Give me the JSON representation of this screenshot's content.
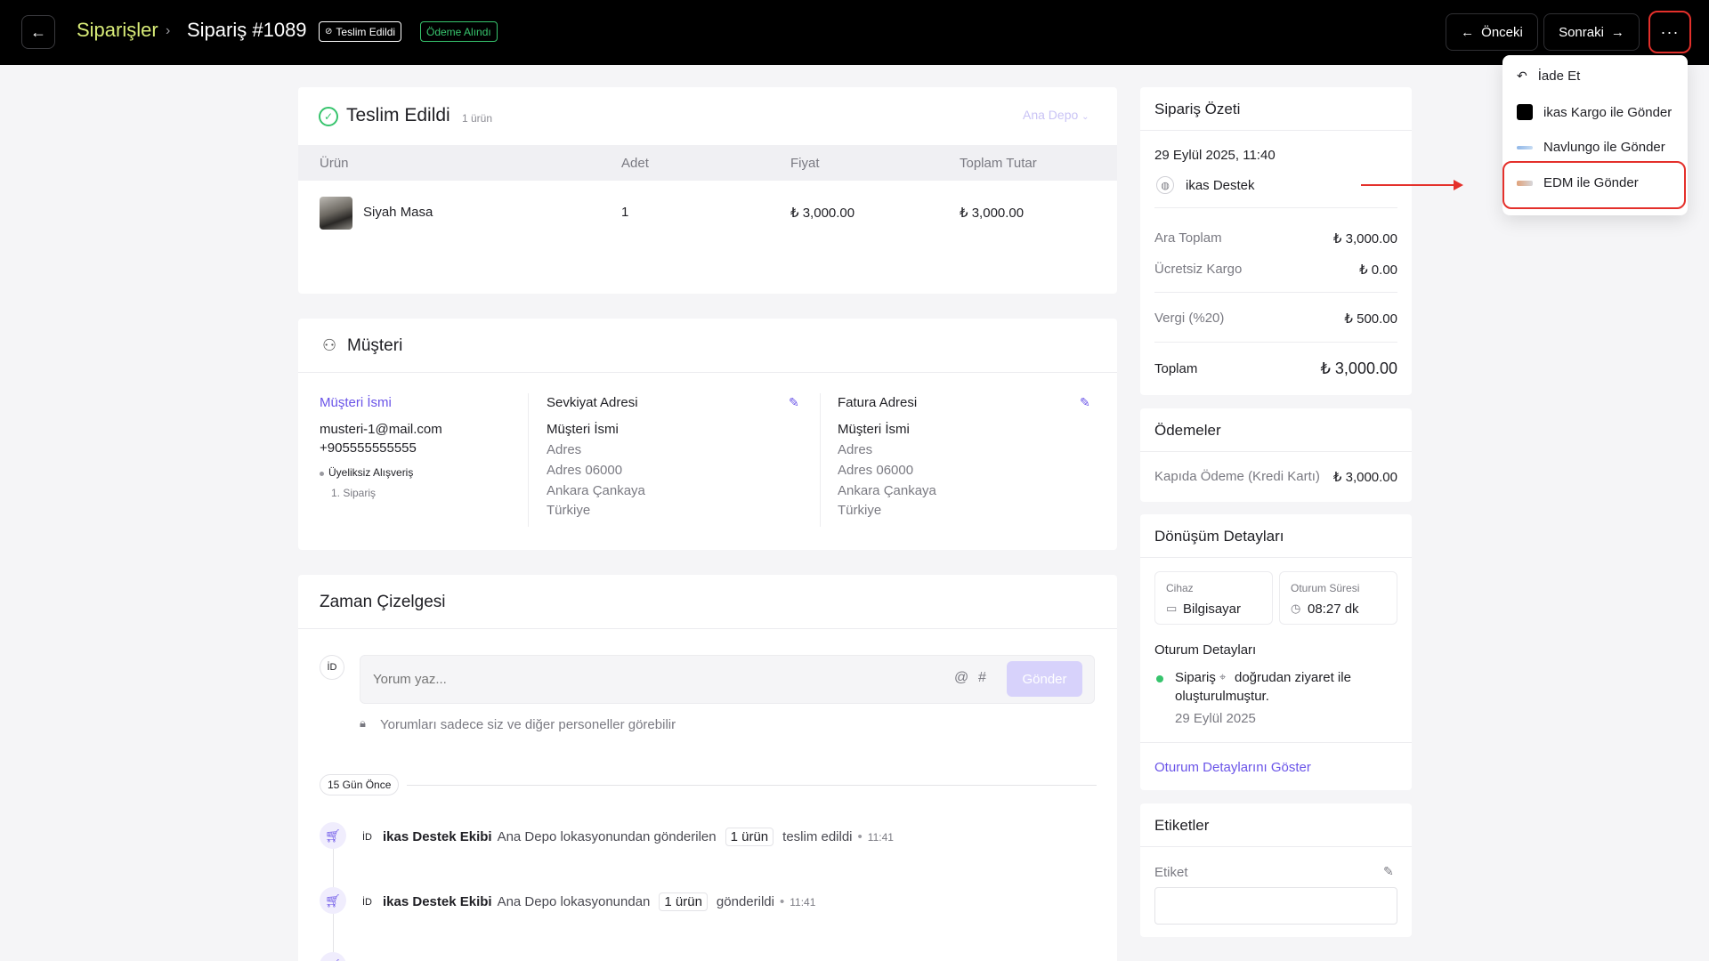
{
  "header": {
    "breadcrumb_root": "Siparişler",
    "breadcrumb_current": "Sipariş #1089",
    "tag_delivered": "Teslim Edildi",
    "tag_paid": "Ödeme Alındı",
    "prev_label": "Önceki",
    "next_label": "Sonraki",
    "more_label": "···"
  },
  "menu": {
    "items": [
      {
        "label": "İade Et",
        "icon": "undo-icon"
      },
      {
        "label": "ikas Kargo ile Gönder",
        "icon": "ikas-kargo-logo"
      },
      {
        "label": "Navlungo ile Gönder",
        "icon": "navlungo-logo"
      },
      {
        "label": "EDM ile Gönder",
        "icon": "edm-logo"
      }
    ]
  },
  "delivery": {
    "title": "Teslim Edildi",
    "count": "1 ürün",
    "warehouse": "Ana Depo",
    "columns": [
      "Ürün",
      "Adet",
      "Fiyat",
      "Toplam Tutar"
    ],
    "rows": [
      {
        "name": "Siyah Masa",
        "qty": "1",
        "price": "₺ 3,000.00",
        "total": "₺ 3,000.00"
      }
    ]
  },
  "customer": {
    "title": "Müşteri",
    "name_link": "Müşteri İsmi",
    "email": "musteri-1@mail.com",
    "phone": "+905555555555",
    "membership": "Üyeliksiz Alışveriş",
    "order_no": "1. Sipariş",
    "shipping": {
      "title": "Sevkiyat Adresi",
      "lines": [
        "Müşteri İsmi",
        "Adres",
        "Adres 06000",
        "Ankara Çankaya",
        "Türkiye"
      ]
    },
    "billing": {
      "title": "Fatura Adresi",
      "lines": [
        "Müşteri İsmi",
        "Adres",
        "Adres 06000",
        "Ankara Çankaya",
        "Türkiye"
      ]
    }
  },
  "timeline": {
    "title": "Zaman Çizelgesi",
    "avatar": "İD",
    "comment_placeholder": "Yorum yaz...",
    "send_label": "Gönder",
    "privacy_note": "Yorumları sadece siz ve diğer personeller görebilir",
    "date_chip": "15 Gün Önce",
    "events": [
      {
        "avatar": "İD",
        "actor": "ikas Destek Ekibi",
        "text_before": "Ana Depo lokasyonundan gönderilen",
        "chip": "1 ürün",
        "text_after": "teslim edildi",
        "time": "11:41"
      },
      {
        "avatar": "İD",
        "actor": "ikas Destek Ekibi",
        "text_before": "Ana Depo lokasyonundan",
        "chip": "1 ürün",
        "text_after": "gönderildi",
        "time": "11:41"
      }
    ]
  },
  "summary": {
    "title": "Sipariş Özeti",
    "date": "29 Eylül 2025, 11:40",
    "channel": "ikas Destek",
    "lines": [
      {
        "label": "Ara Toplam",
        "value": "₺ 3,000.00"
      },
      {
        "label": "Ücretsiz Kargo",
        "value": "₺ 0.00"
      },
      {
        "label": "Vergi (%20)",
        "value": "₺ 500.00"
      }
    ],
    "total_label": "Toplam",
    "total_value": "₺ 3,000.00"
  },
  "payments": {
    "title": "Ödemeler",
    "method": "Kapıda Ödeme (Kredi Kartı)",
    "amount": "₺ 3,000.00"
  },
  "conversion": {
    "title": "Dönüşüm Detayları",
    "device_label": "Cihaz",
    "device_value": "Bilgisayar",
    "session_label": "Oturum Süresi",
    "session_value": "08:27 dk",
    "session_details_title": "Oturum Detayları",
    "event_line1": "Sipariş",
    "event_line1b": "doğrudan ziyaret ile",
    "event_line2": "oluşturulmuştur.",
    "event_date": "29 Eylül 2025",
    "show_link": "Oturum Detaylarını Göster"
  },
  "tags": {
    "title": "Etiketler",
    "field_label": "Etiket"
  },
  "colors": {
    "accent": "#6a54e8",
    "highlight": "#e4302b",
    "success": "#37c46d",
    "breadcrumb": "#d9ec78"
  }
}
